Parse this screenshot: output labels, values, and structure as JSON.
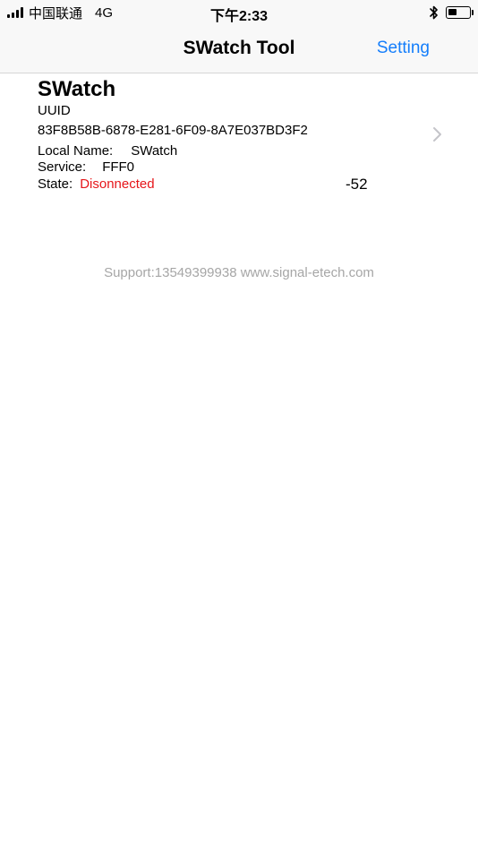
{
  "status_bar": {
    "carrier": "中国联通",
    "network": "4G",
    "time": "下午2:33",
    "battery_level": 0.45
  },
  "nav": {
    "title": "SWatch Tool",
    "setting_label": "Setting"
  },
  "device": {
    "name": "SWatch",
    "uuid_label": "UUID",
    "uuid": "83F8B58B-6878-E281-6F09-8A7E037BD3F2",
    "local_name_label": "Local Name:",
    "local_name": "SWatch",
    "service_label": "Service:",
    "service": "FFF0",
    "state_label": "State:",
    "state": "Disonnected",
    "rssi": "-52"
  },
  "footer": {
    "support": "Support:13549399938 www.signal-etech.com"
  },
  "colors": {
    "accent": "#147efb",
    "state_error": "#e6161a",
    "muted": "#a6a6a6"
  }
}
